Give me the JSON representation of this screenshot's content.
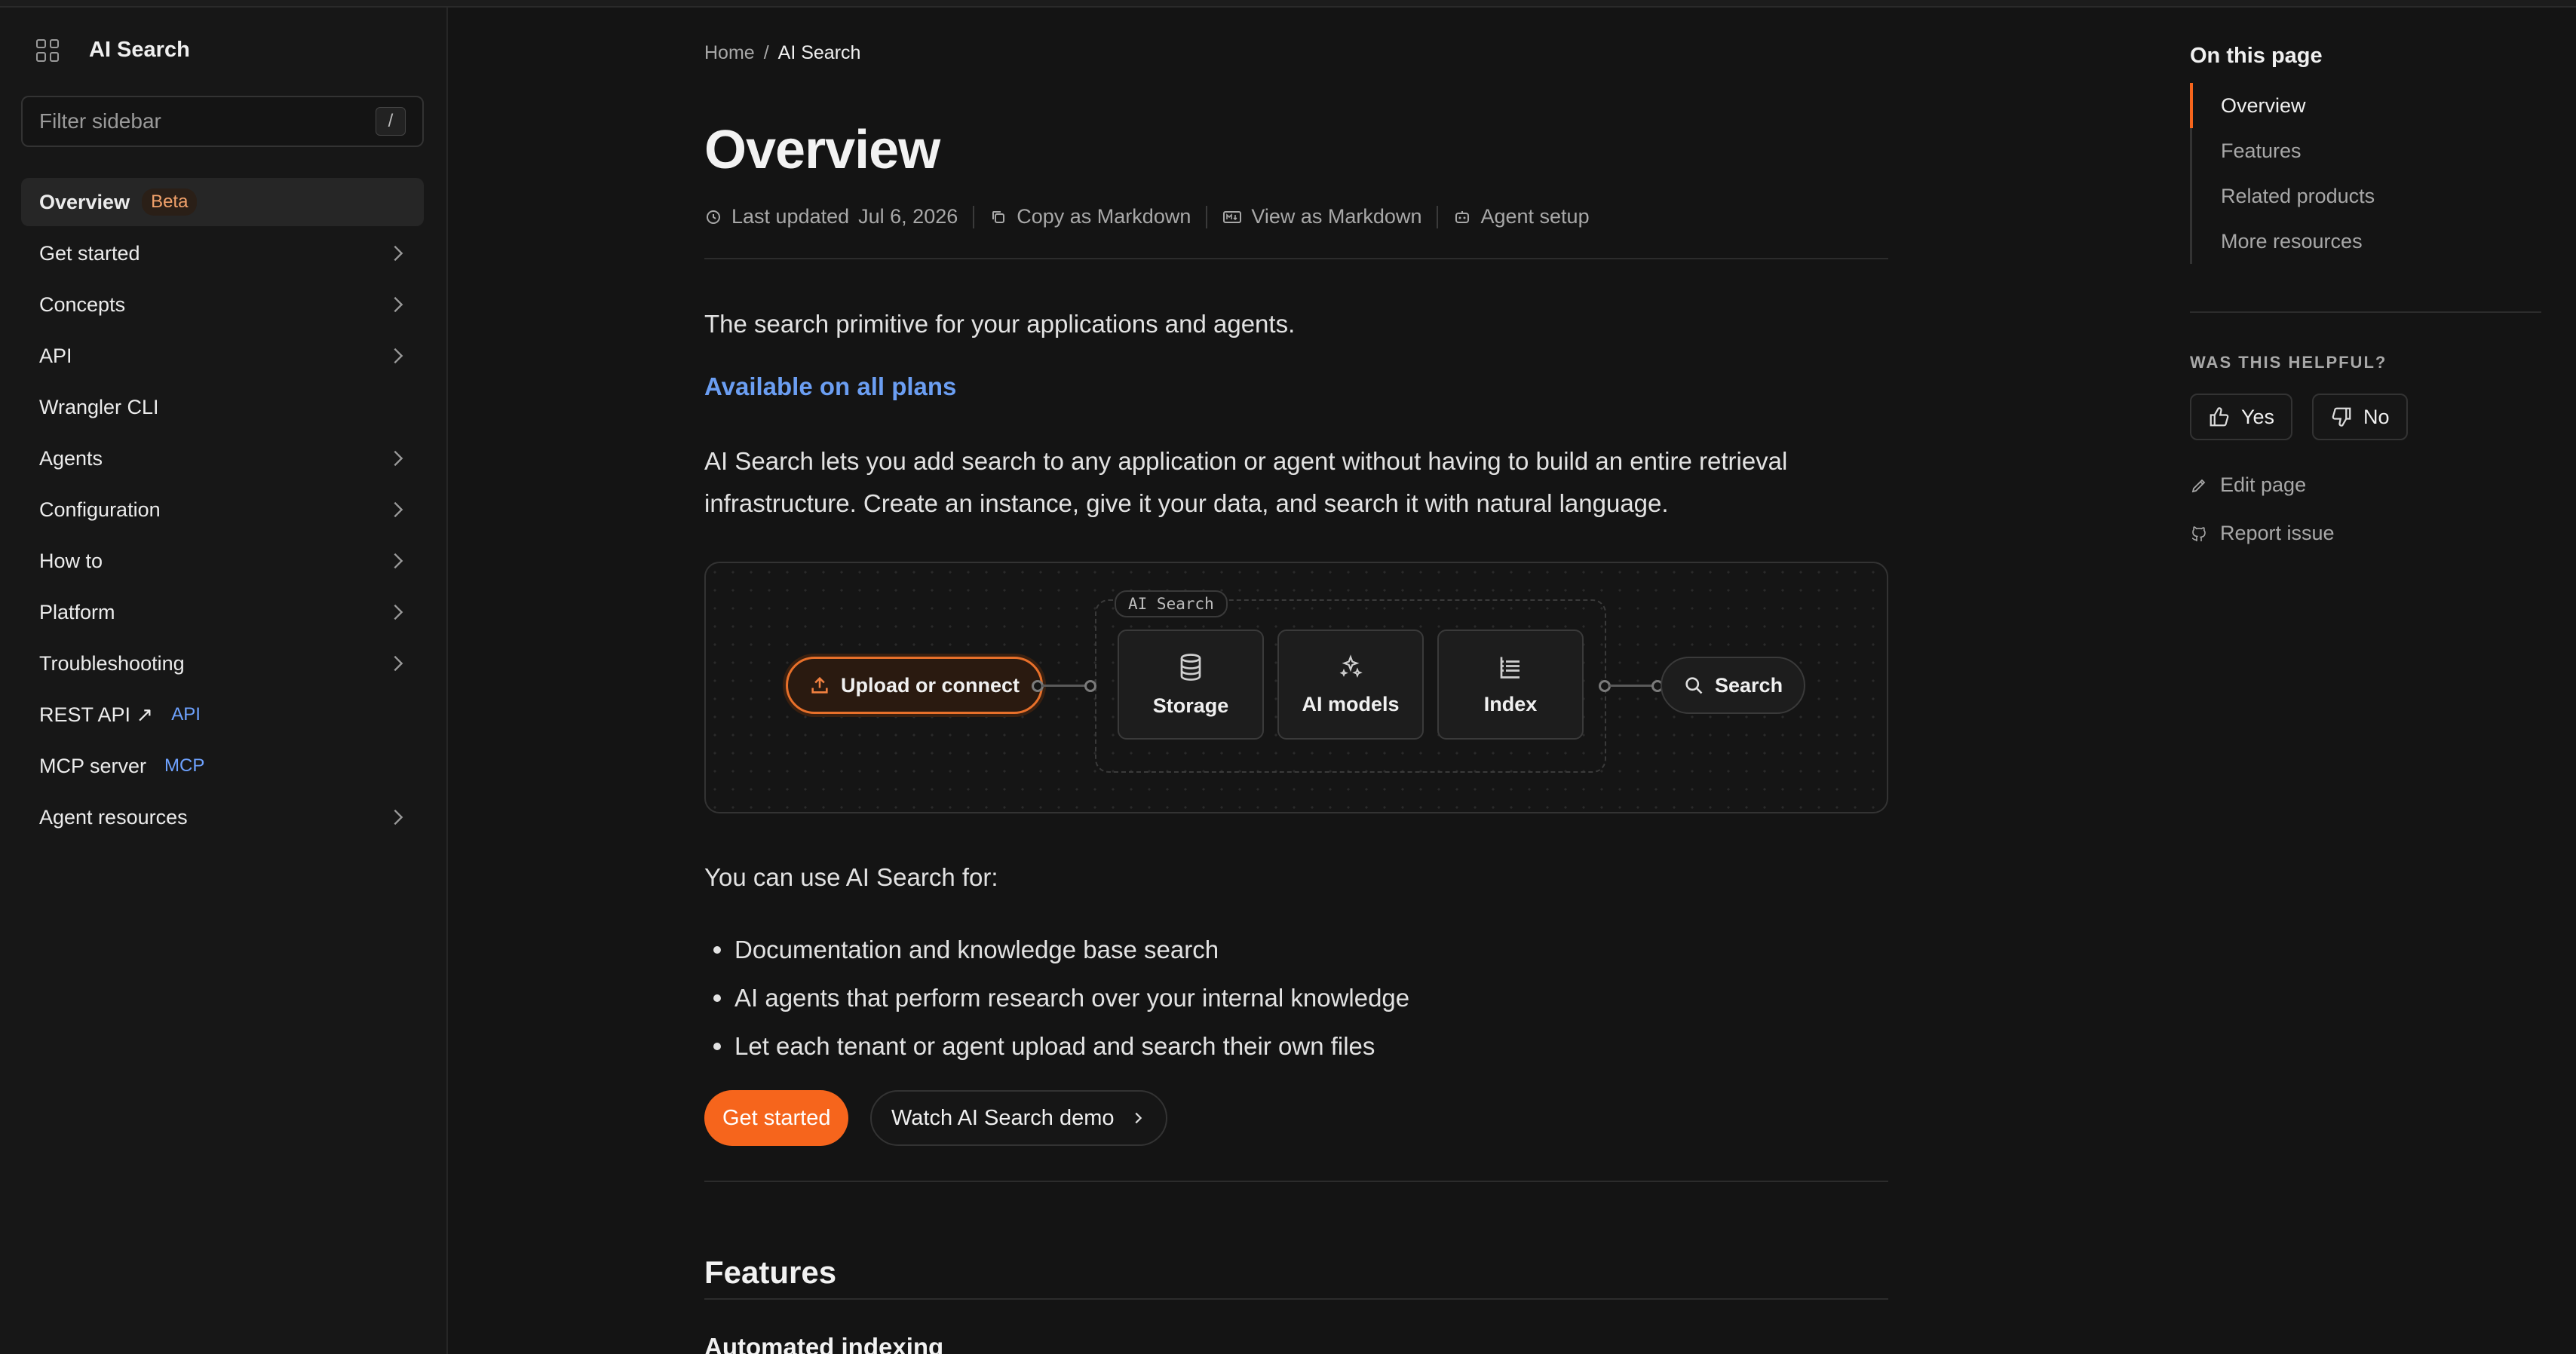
{
  "sidebar": {
    "title": "AI Search",
    "filter_placeholder": "Filter sidebar",
    "filter_shortcut": "/",
    "items": [
      {
        "label": "Overview",
        "badge": "Beta",
        "active": true,
        "chevron": false
      },
      {
        "label": "Get started",
        "chevron": true
      },
      {
        "label": "Concepts",
        "chevron": true
      },
      {
        "label": "API",
        "chevron": true
      },
      {
        "label": "Wrangler CLI",
        "chevron": false
      },
      {
        "label": "Agents",
        "chevron": true
      },
      {
        "label": "Configuration",
        "chevron": true
      },
      {
        "label": "How to",
        "chevron": true
      },
      {
        "label": "Platform",
        "chevron": true
      },
      {
        "label": "Troubleshooting",
        "chevron": true
      },
      {
        "label": "REST API ↗",
        "badge": "API",
        "chevron": false
      },
      {
        "label": "MCP server",
        "badge": "MCP",
        "chevron": false
      },
      {
        "label": "Agent resources",
        "chevron": true
      }
    ]
  },
  "breadcrumb": {
    "home": "Home",
    "sep": "/",
    "current": "AI Search"
  },
  "page": {
    "title": "Overview",
    "meta": {
      "last_updated_label": "Last updated",
      "last_updated_date": "Jul 6, 2026",
      "copy_markdown": "Copy as Markdown",
      "view_markdown": "View as Markdown",
      "agent_setup": "Agent setup"
    },
    "intro": "The search primitive for your applications and agents.",
    "plans": "Available on all plans",
    "description": "AI Search lets you add search to any application or agent without having to build an entire retrieval infrastructure. Create an instance, give it your data, and search it with natural language.",
    "diagram": {
      "group_label": "AI Search",
      "upload": "Upload or connect",
      "storage": "Storage",
      "models": "AI models",
      "index": "Index",
      "search": "Search"
    },
    "uses_intro": "You can use AI Search for:",
    "uses": [
      "Documentation and knowledge base search",
      "AI agents that perform research over your internal knowledge",
      "Let each tenant or agent upload and search their own files"
    ],
    "cta_primary": "Get started",
    "cta_secondary": "Watch AI Search demo",
    "features_heading": "Features",
    "subheading": "Automated indexing"
  },
  "toc": {
    "title": "On this page",
    "items": [
      "Overview",
      "Features",
      "Related products",
      "More resources"
    ],
    "helpful": "WAS THIS HELPFUL?",
    "yes": "Yes",
    "no": "No",
    "edit": "Edit page",
    "report": "Report issue"
  },
  "colors": {
    "accent": "#f6651c",
    "link": "#6b9ef2",
    "background": "#141414"
  }
}
